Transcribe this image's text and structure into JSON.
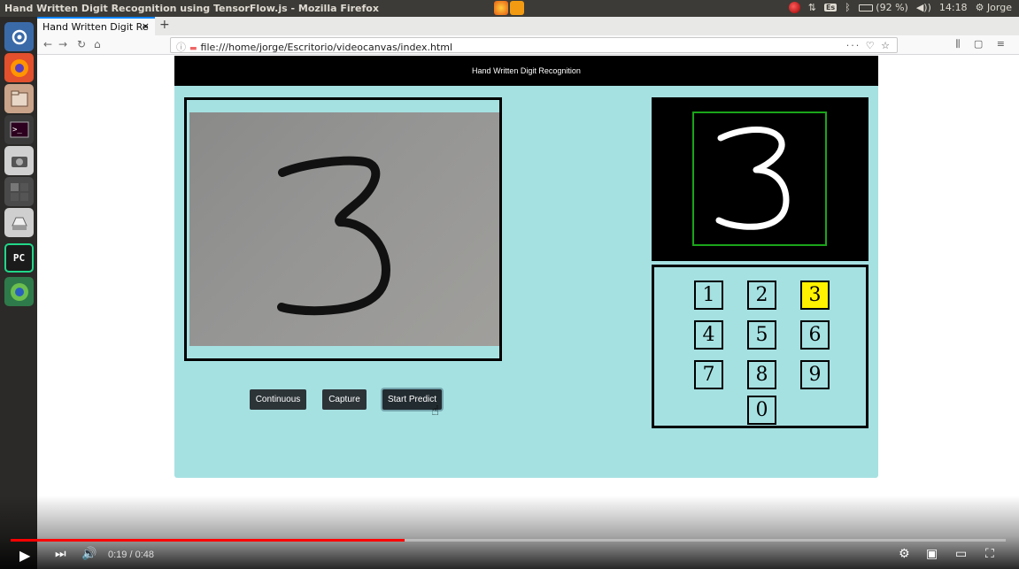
{
  "os": {
    "window_title": "Hand Written Digit Recognition using TensorFlow.js - Mozilla Firefox",
    "tray": {
      "keyboard": "Es",
      "battery": "(92 %)",
      "clock": "14:18",
      "user": "Jorge"
    }
  },
  "browser": {
    "tab_title": "Hand Written Digit Re",
    "tab_close": "×",
    "new_tab": "+",
    "url": "file:///home/jorge/Escritorio/videocanvas/index.html",
    "url_actions": "··· ♡ ☆",
    "right_icons": "⫼ ▢ ≡"
  },
  "page": {
    "header_title": "Hand Written Digit Recognition",
    "camera_digit": "3",
    "roi_digit": "3",
    "buttons": {
      "continuous": "Continuous",
      "capture": "Capture",
      "start_predict": "Start Predict"
    },
    "keypad": [
      {
        "label": "1",
        "highlighted": false
      },
      {
        "label": "2",
        "highlighted": false
      },
      {
        "label": "3",
        "highlighted": true
      },
      {
        "label": "4",
        "highlighted": false
      },
      {
        "label": "5",
        "highlighted": false
      },
      {
        "label": "6",
        "highlighted": false
      },
      {
        "label": "7",
        "highlighted": false
      },
      {
        "label": "8",
        "highlighted": false
      },
      {
        "label": "9",
        "highlighted": false
      },
      {
        "label": "0",
        "highlighted": false
      }
    ],
    "colors": {
      "app_bg": "#a6e1e2",
      "highlight": "#fff200",
      "roi_border": "#1aa51a"
    }
  },
  "player": {
    "time": "0:19 / 0:48",
    "progress_fraction": 0.396
  }
}
